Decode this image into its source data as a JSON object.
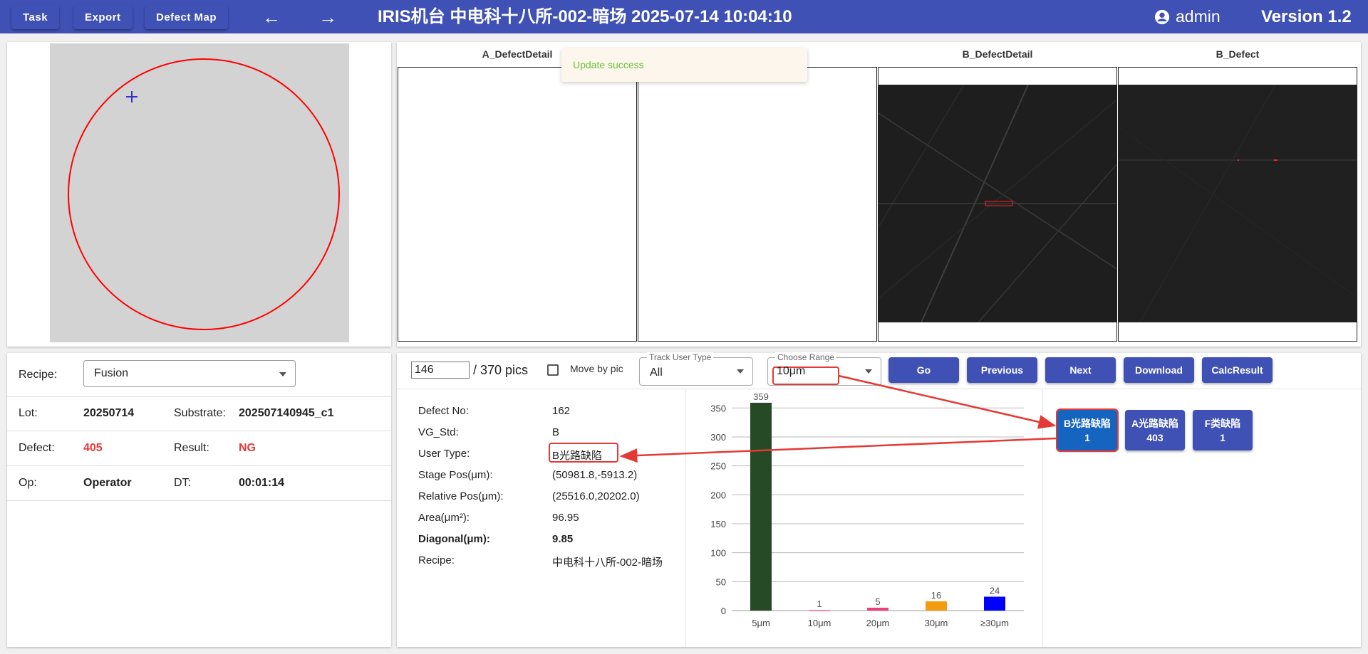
{
  "header": {
    "task_label": "Task",
    "export_label": "Export",
    "defect_map_label": "Defect Map",
    "back_arrow": "←",
    "forward_arrow": "→",
    "title": "IRIS机台   中电科十八所-002-暗场   2025-07-14 10:04:10",
    "user": "admin",
    "version": "Version 1.2",
    "user_icon": "account-circle-icon"
  },
  "info": {
    "recipe_label": "Recipe:",
    "recipe_value": "Fusion",
    "lot_label": "Lot:",
    "lot_value": "20250714",
    "substrate_label": "Substrate:",
    "substrate_value": "202507140945_c1",
    "defect_label": "Defect:",
    "defect_value": "405",
    "result_label": "Result:",
    "result_value": "NG",
    "op_label": "Op:",
    "op_value": "Operator",
    "dt_label": "DT:",
    "dt_value": "00:01:14"
  },
  "images": {
    "col1": "A_DefectDetail",
    "col2": "",
    "col3": "B_DefectDetail",
    "col4": "B_Defect"
  },
  "toast": "Update success",
  "controls": {
    "pic_value": "146",
    "pic_total": "/ 370 pics",
    "move_by_pic": "Move by pic",
    "track_user_type_label": "Track User Type",
    "track_user_type_value": "All",
    "choose_range_label": "Choose Range",
    "choose_range_value": "10μm",
    "go": "Go",
    "previous": "Previous",
    "next": "Next",
    "download": "Download",
    "calc_result": "CalcResult"
  },
  "detail": {
    "defect_no_label": "Defect No:",
    "defect_no_value": "162",
    "vg_std_label": "VG_Std:",
    "vg_std_value": "B",
    "user_type_label": "User Type:",
    "user_type_value": "B光路缺陷",
    "stage_pos_label": "Stage Pos(μm):",
    "stage_pos_value": "(50981.8,-5913.2)",
    "relative_pos_label": "Relative Pos(μm):",
    "relative_pos_value": "(25516.0,20202.0)",
    "area_label": "Area(μm²):",
    "area_value": "96.95",
    "diagonal_label": "Diagonal(μm):",
    "diagonal_value": "9.85",
    "recipe_label": "Recipe:",
    "recipe_value": "中电科十八所-002-暗场"
  },
  "categories": [
    {
      "name": "B光路缺陷",
      "count": "1"
    },
    {
      "name": "A光路缺陷",
      "count": "403"
    },
    {
      "name": "F类缺陷",
      "count": "1"
    }
  ],
  "colors": {
    "header": "#3f51b5",
    "accent_red": "#e53935",
    "bar_5um": "#254a25",
    "bar_10um": "#f06292",
    "bar_20um": "#ec407a",
    "bar_30um": "#f39c12",
    "bar_30plus": "#0000ff"
  },
  "chart_data": {
    "type": "bar",
    "categories": [
      "5μm",
      "10μm",
      "20μm",
      "30μm",
      "≥30μm"
    ],
    "values": [
      359,
      1,
      5,
      16,
      24
    ],
    "yticks": [
      0,
      50,
      100,
      150,
      200,
      250,
      300,
      350
    ],
    "ylim": [
      0,
      370
    ],
    "title": "",
    "xlabel": "",
    "ylabel": "",
    "grid": true
  }
}
